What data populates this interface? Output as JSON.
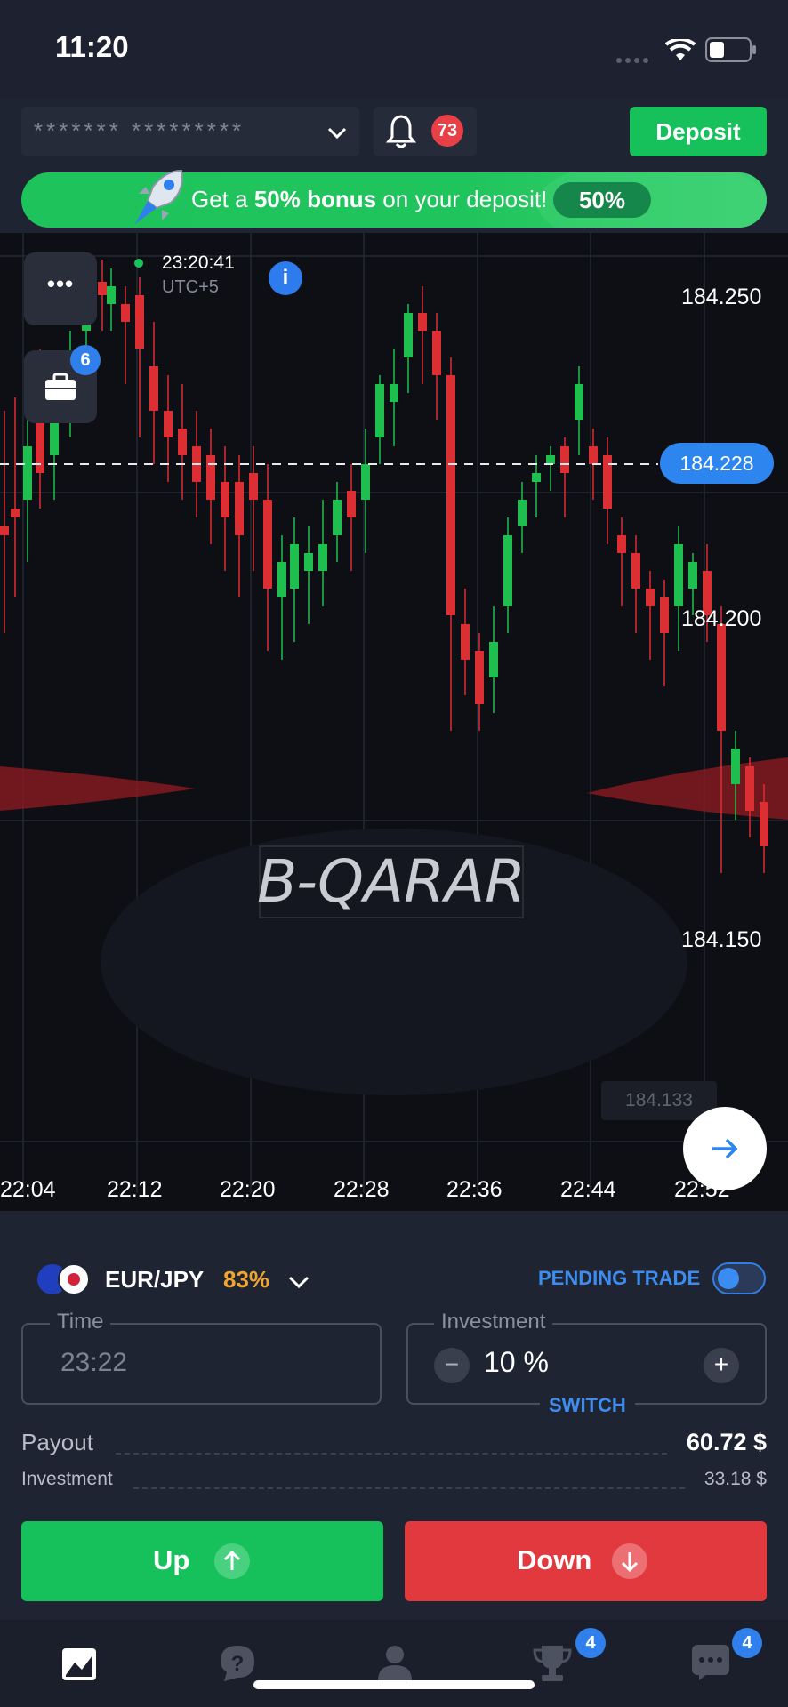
{
  "status_bar": {
    "time": "11:20"
  },
  "header": {
    "account_masked": "******* *********",
    "notifications_count": "73",
    "deposit_label": "Deposit"
  },
  "banner": {
    "text_before": "Get a ",
    "text_bold": "50% bonus",
    "text_after": " on your deposit!",
    "pill": "50%"
  },
  "chart": {
    "clock": "23:20:41",
    "timezone": "UTC+5",
    "portfolio_badge": "6",
    "current_price": "184.228",
    "low_price": "184.133",
    "watermark": "B-QARAR",
    "price_labels": [
      "184.250",
      "184.200",
      "184.150"
    ],
    "time_labels": [
      "22:04",
      "22:12",
      "22:20",
      "22:28",
      "22:36",
      "22:44",
      "22:52"
    ]
  },
  "trade": {
    "pair": "EUR/JPY",
    "payout_pct": "83%",
    "pending_label": "PENDING TRADE",
    "time_label": "Time",
    "time_value": "23:22",
    "investment_label": "Investment",
    "investment_value": "10 %",
    "switch_label": "SWITCH",
    "payout_label": "Payout",
    "payout_value": "60.72 $",
    "investment_row_label": "Investment",
    "investment_row_value": "33.18 $",
    "up_label": "Up",
    "down_label": "Down"
  },
  "nav": {
    "tournaments_badge": "4",
    "chat_badge": "4"
  },
  "colors": {
    "green": "#16c15c",
    "red": "#e1393e",
    "blue": "#2d86f0",
    "orange": "#f0a530"
  }
}
